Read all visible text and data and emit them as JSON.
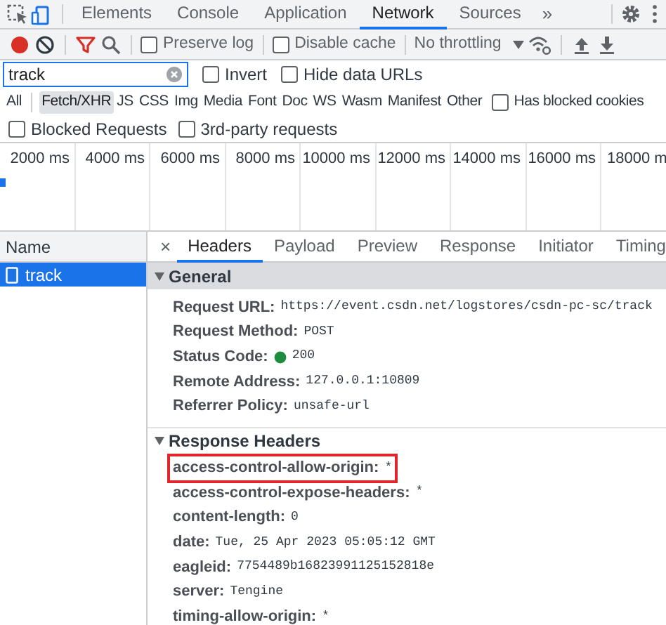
{
  "panel_tabs": [
    {
      "label": "Elements",
      "selected": false
    },
    {
      "label": "Console",
      "selected": false
    },
    {
      "label": "Application",
      "selected": false
    },
    {
      "label": "Network",
      "selected": true
    },
    {
      "label": "Sources",
      "selected": false
    }
  ],
  "more_tabs": "»",
  "toolbar": {
    "recording": true,
    "checkboxes": [
      {
        "label": "Preserve log",
        "checked": false
      },
      {
        "label": "Disable cache",
        "checked": false
      }
    ],
    "throttling": "No throttling"
  },
  "filter": {
    "value": "track",
    "checkboxes": [
      {
        "label": "Invert",
        "checked": false
      },
      {
        "label": "Hide data URLs",
        "checked": false
      }
    ]
  },
  "type_filters": [
    {
      "label": "All",
      "selected": false
    },
    {
      "label": "Fetch/XHR",
      "selected": true
    },
    {
      "label": "JS",
      "selected": false
    },
    {
      "label": "CSS",
      "selected": false
    },
    {
      "label": "Img",
      "selected": false
    },
    {
      "label": "Media",
      "selected": false
    },
    {
      "label": "Font",
      "selected": false
    },
    {
      "label": "Doc",
      "selected": false
    },
    {
      "label": "WS",
      "selected": false
    },
    {
      "label": "Wasm",
      "selected": false
    },
    {
      "label": "Manifest",
      "selected": false
    },
    {
      "label": "Other",
      "selected": false
    }
  ],
  "blocked_cookies": {
    "label": "Has blocked cookies",
    "checked": false
  },
  "more_checkboxes": [
    {
      "label": "Blocked Requests",
      "checked": false
    },
    {
      "label": "3rd-party requests",
      "checked": false
    }
  ],
  "timeline": {
    "ticks": [
      "2000 ms",
      "4000 ms",
      "6000 ms",
      "8000 ms",
      "10000 ms",
      "12000 ms",
      "14000 ms",
      "16000 ms",
      "18000 m"
    ]
  },
  "requests": {
    "column": "Name",
    "rows": [
      {
        "name": "track",
        "selected": true
      }
    ]
  },
  "detail_close": "×",
  "detail_tabs": [
    {
      "label": "Headers",
      "selected": true
    },
    {
      "label": "Payload",
      "selected": false
    },
    {
      "label": "Preview",
      "selected": false
    },
    {
      "label": "Response",
      "selected": false
    },
    {
      "label": "Initiator",
      "selected": false
    },
    {
      "label": "Timing",
      "selected": false
    }
  ],
  "sections": [
    {
      "title": "General",
      "expanded": true,
      "kind": "general",
      "rows": [
        {
          "key": "Request URL:",
          "value": "https://event.csdn.net/logstores/csdn-pc-sc/track",
          "kind": "plain",
          "highlighted": false
        },
        {
          "key": "Request Method:",
          "value": "POST",
          "kind": "plain",
          "highlighted": false
        },
        {
          "key": "Status Code:",
          "value": "200",
          "kind": "status",
          "highlighted": false
        },
        {
          "key": "Remote Address:",
          "value": "127.0.0.1:10809",
          "kind": "plain",
          "highlighted": false
        },
        {
          "key": "Referrer Policy:",
          "value": "unsafe-url",
          "kind": "plain",
          "highlighted": false
        }
      ]
    },
    {
      "title": "Response Headers",
      "expanded": true,
      "kind": "headers",
      "rows": [
        {
          "key": "access-control-allow-origin:",
          "value": "*",
          "kind": "plain",
          "highlighted": true
        },
        {
          "key": "access-control-expose-headers:",
          "value": "*",
          "kind": "plain",
          "highlighted": false
        },
        {
          "key": "content-length:",
          "value": "0",
          "kind": "plain",
          "highlighted": false
        },
        {
          "key": "date:",
          "value": "Tue, 25 Apr 2023 05:05:12 GMT",
          "kind": "plain",
          "highlighted": false
        },
        {
          "key": "eagleid:",
          "value": "7754489b16823991125152818e",
          "kind": "plain",
          "highlighted": false
        },
        {
          "key": "server:",
          "value": "Tengine",
          "kind": "plain",
          "highlighted": false
        },
        {
          "key": "timing-allow-origin:",
          "value": "*",
          "kind": "plain",
          "highlighted": false
        }
      ]
    }
  ]
}
